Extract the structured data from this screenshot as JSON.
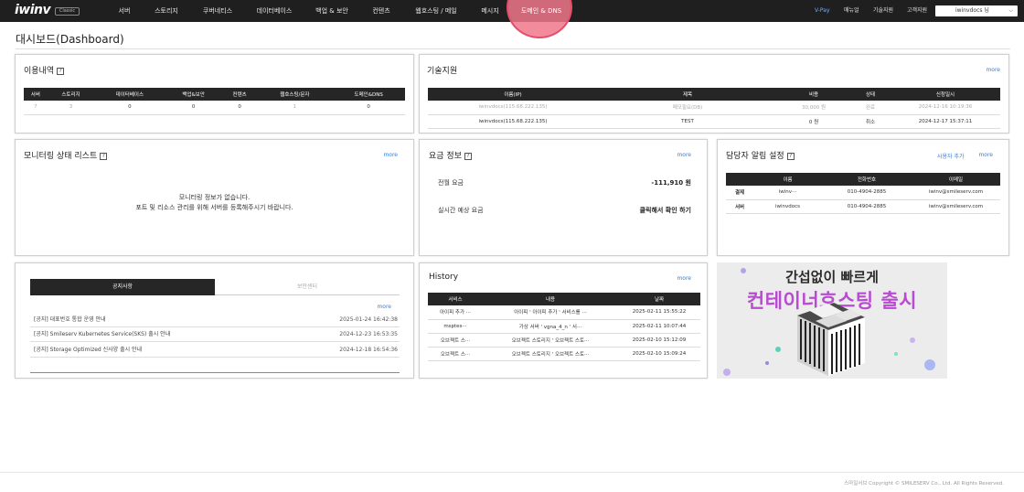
{
  "header": {
    "logo": "iwinv",
    "logo_badge": "Classic",
    "nav": [
      "서버",
      "스토리지",
      "쿠버네티스",
      "데이터베이스",
      "백업 & 보안",
      "컨텐츠",
      "웹호스팅 / 메일",
      "메시지",
      "도메인 & DNS"
    ],
    "right_links": [
      "V-Pay",
      "매뉴얼",
      "기술지원",
      "고객지원"
    ],
    "user": "iwinvdocs 님",
    "colors": {
      "bar": "#1f1f1f",
      "active_highlight": "#e44d6a",
      "vpay": "#6fb2ff"
    }
  },
  "page_title": "대시보드(Dashboard)",
  "usage": {
    "title": "이용내역",
    "help": "?",
    "columns": [
      "서버",
      "스토리지",
      "데이터베이스",
      "백업&보안",
      "컨텐츠",
      "웹호스팅/문자",
      "도메인&DNS"
    ],
    "values": [
      "7",
      "3",
      "0",
      "0",
      "0",
      "1",
      "0"
    ]
  },
  "tech": {
    "title": "기술지원",
    "more": "more",
    "columns": [
      "이름(IP)",
      "제목",
      "비용",
      "상태",
      "신청일시"
    ],
    "rows": [
      [
        "iwinvdocs(115.68.222.135)",
        "메모필요(DB)",
        "30,000 원",
        "완료",
        "2024-12-16 10:19:36"
      ],
      [
        "iwinvdocs(115.68.222.135)",
        "TEST",
        "0 원",
        "취소",
        "2024-12-17 15:37:11"
      ]
    ]
  },
  "monitor": {
    "title": "모니터링 상태 리스트",
    "help": "?",
    "more": "more",
    "empty_line1": "모니터링 정보가 없습니다.",
    "empty_line2": "포트 및 리소스 관리를 위해 서버를 등록해주시기 바랍니다."
  },
  "fee": {
    "title": "요금 정보",
    "help": "?",
    "more": "more",
    "last_month_label": "전월 요금",
    "last_month_value": "-111,910 원",
    "realtime_label": "실시간 예상 요금",
    "realtime_value": "클릭해서 확인 하기"
  },
  "alarm": {
    "title": "담당자 알림 설정",
    "help": "?",
    "add_user": "사용자 추가",
    "more": "more",
    "columns": [
      "",
      "이름",
      "전화번호",
      "이메일"
    ],
    "rows": [
      [
        "결제",
        "iwinv···",
        "010-4904-2885",
        "iwinv@smileserv.com"
      ],
      [
        "서버",
        "iwinvdocs",
        "010-4904-2885",
        "iwinv@smileserv.com"
      ]
    ]
  },
  "notice": {
    "tab_on": "공지사항",
    "tab_off": "보안센터",
    "more": "more",
    "items": [
      {
        "title": "[공지] 대표번호 통합 운영 안내",
        "date": "2025-01-24 16:42:38"
      },
      {
        "title": "[공지] Smileserv Kubernetes Service(SKS) 출시 안내",
        "date": "2024-12-23 16:53:35"
      },
      {
        "title": "[공지] Storage Optimized 신사양 출시 안내",
        "date": "2024-12-18 16:54:36"
      }
    ]
  },
  "history": {
    "title": "History",
    "more": "more",
    "columns": [
      "서비스",
      "내용",
      "날짜"
    ],
    "rows": [
      [
        "아이피 추가 ···",
        "아이피 ' 아이피 추가 ' 서비스를 ···",
        "2025-02-11 15:55:22"
      ],
      [
        "msptes···",
        "가상 서버 ' vgna_4_n ' 서···",
        "2025-02-11 10:07:44"
      ],
      [
        "오브젝트 스···",
        "오브젝트 스토리지 ' 오브젝트 스토···",
        "2025-02-10 15:12:09"
      ],
      [
        "오브젝트 스···",
        "오브젝트 스토리지 ' 오브젝트 스토···",
        "2025-02-10 15:09:24"
      ]
    ]
  },
  "banner": {
    "line1": "간섭없이 빠르게",
    "line2": "컨테이너호스팅 출시"
  },
  "footer": "스마일서브 Copyright © SMILESERV Co., Ltd. All Rights Reserved."
}
